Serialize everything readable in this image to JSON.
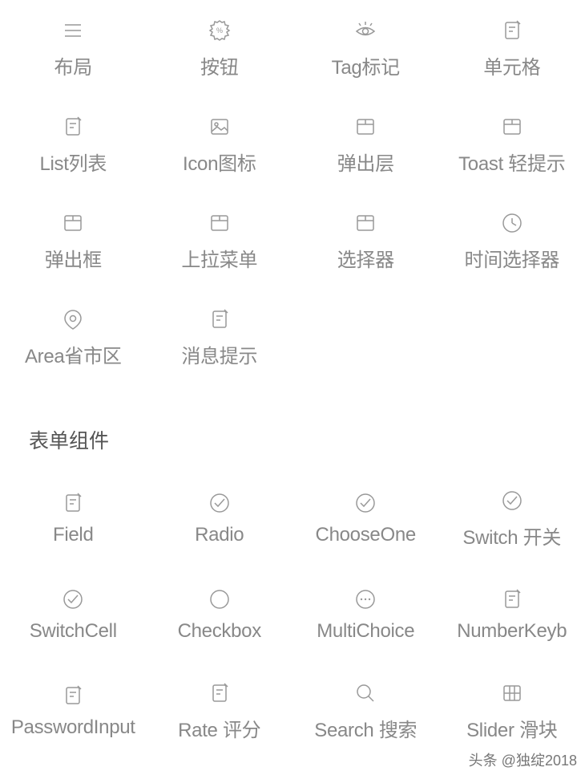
{
  "section1": {
    "items": [
      {
        "label": "布局",
        "icon": "menu-icon"
      },
      {
        "label": "按钮",
        "icon": "badge-icon"
      },
      {
        "label": "Tag标记",
        "icon": "eye-icon"
      },
      {
        "label": "单元格",
        "icon": "note-icon"
      },
      {
        "label": "List列表",
        "icon": "note-icon"
      },
      {
        "label": "Icon图标",
        "icon": "image-icon"
      },
      {
        "label": "弹出层",
        "icon": "box-icon"
      },
      {
        "label": "Toast 轻提示",
        "icon": "box-icon"
      },
      {
        "label": "弹出框",
        "icon": "box-icon"
      },
      {
        "label": "上拉菜单",
        "icon": "box-icon"
      },
      {
        "label": "选择器",
        "icon": "box-icon"
      },
      {
        "label": "时间选择器",
        "icon": "clock-icon"
      },
      {
        "label": "Area省市区",
        "icon": "location-icon"
      },
      {
        "label": "消息提示",
        "icon": "note-icon"
      }
    ]
  },
  "section2": {
    "title": "表单组件",
    "items": [
      {
        "label": "Field",
        "icon": "note-icon"
      },
      {
        "label": "Radio",
        "icon": "check-circle-icon"
      },
      {
        "label": "ChooseOne",
        "icon": "check-circle-icon"
      },
      {
        "label": "Switch 开关",
        "icon": "check-circle-icon"
      },
      {
        "label": "SwitchCell",
        "icon": "check-circle-icon"
      },
      {
        "label": "Checkbox",
        "icon": "circle-icon"
      },
      {
        "label": "MultiChoice",
        "icon": "more-circle-icon"
      },
      {
        "label": "NumberKeyb",
        "icon": "note-icon"
      },
      {
        "label": "PasswordInput",
        "icon": "note-icon"
      },
      {
        "label": "Rate 评分",
        "icon": "note-icon"
      },
      {
        "label": "Search 搜索",
        "icon": "search-icon"
      },
      {
        "label": "Slider 滑块",
        "icon": "grid-icon"
      }
    ]
  },
  "watermark": "头条 @独绽2018"
}
